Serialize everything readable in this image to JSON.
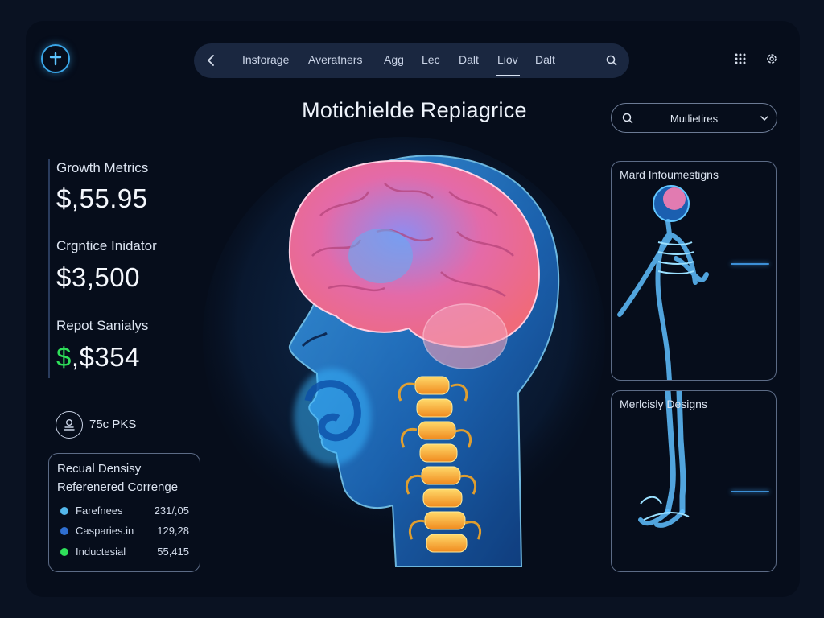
{
  "nav": {
    "tabs": [
      {
        "label": "Insforage"
      },
      {
        "label": "Averatners"
      },
      {
        "label": "Agg"
      },
      {
        "label": "Lec"
      },
      {
        "label": "Dalt"
      },
      {
        "label": "Liov"
      },
      {
        "label": "Dalt"
      }
    ],
    "active_tab_index": 5
  },
  "page_title": "Motichielde Repiagrice",
  "filter": {
    "value": "Mutlietires"
  },
  "metrics": [
    {
      "label": "Growth Metrics",
      "value": "$,55.95"
    },
    {
      "label": "Crgntice Inidator",
      "value": "$3,500"
    },
    {
      "label": "Repot Sanialys",
      "value_prefix": "$",
      "value": ",$354"
    }
  ],
  "user_count": "75c PKS",
  "legend": {
    "title": "Recual Densisy",
    "subtitle": "Referenered Correnge",
    "items": [
      {
        "name": "Farefnees",
        "value": "231/,05",
        "color": "#53b7ec"
      },
      {
        "name": "Casparies.in",
        "value": "129,28",
        "color": "#2f6fd1"
      },
      {
        "name": "Inductesial",
        "value": "55,415",
        "color": "#2fe05a"
      }
    ]
  },
  "cards": [
    {
      "title": "Mard Infoumestigns"
    },
    {
      "title": "Merlcisly Designs"
    }
  ],
  "colors": {
    "background": "#0a1222",
    "panel": "#060d1b",
    "accent": "#3aa6e8",
    "brain": "#e85d93",
    "spine": "#f5a623",
    "positive": "#2fe05a"
  }
}
